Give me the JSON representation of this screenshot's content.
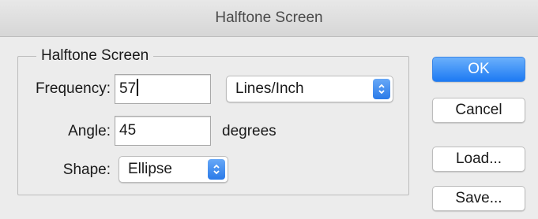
{
  "window": {
    "title": "Halftone Screen"
  },
  "group": {
    "legend": "Halftone Screen"
  },
  "frequency": {
    "label": "Frequency:",
    "value": "57",
    "unit_selected": "Lines/Inch"
  },
  "angle": {
    "label": "Angle:",
    "value": "45",
    "unit": "degrees"
  },
  "shape": {
    "label": "Shape:",
    "selected": "Ellipse"
  },
  "buttons": {
    "ok": "OK",
    "cancel": "Cancel",
    "load": "Load...",
    "save": "Save..."
  },
  "colors": {
    "accent": "#1d7af3",
    "background": "#ececec"
  },
  "icons": {
    "popup_arrows": "updown-chevron-icon"
  }
}
